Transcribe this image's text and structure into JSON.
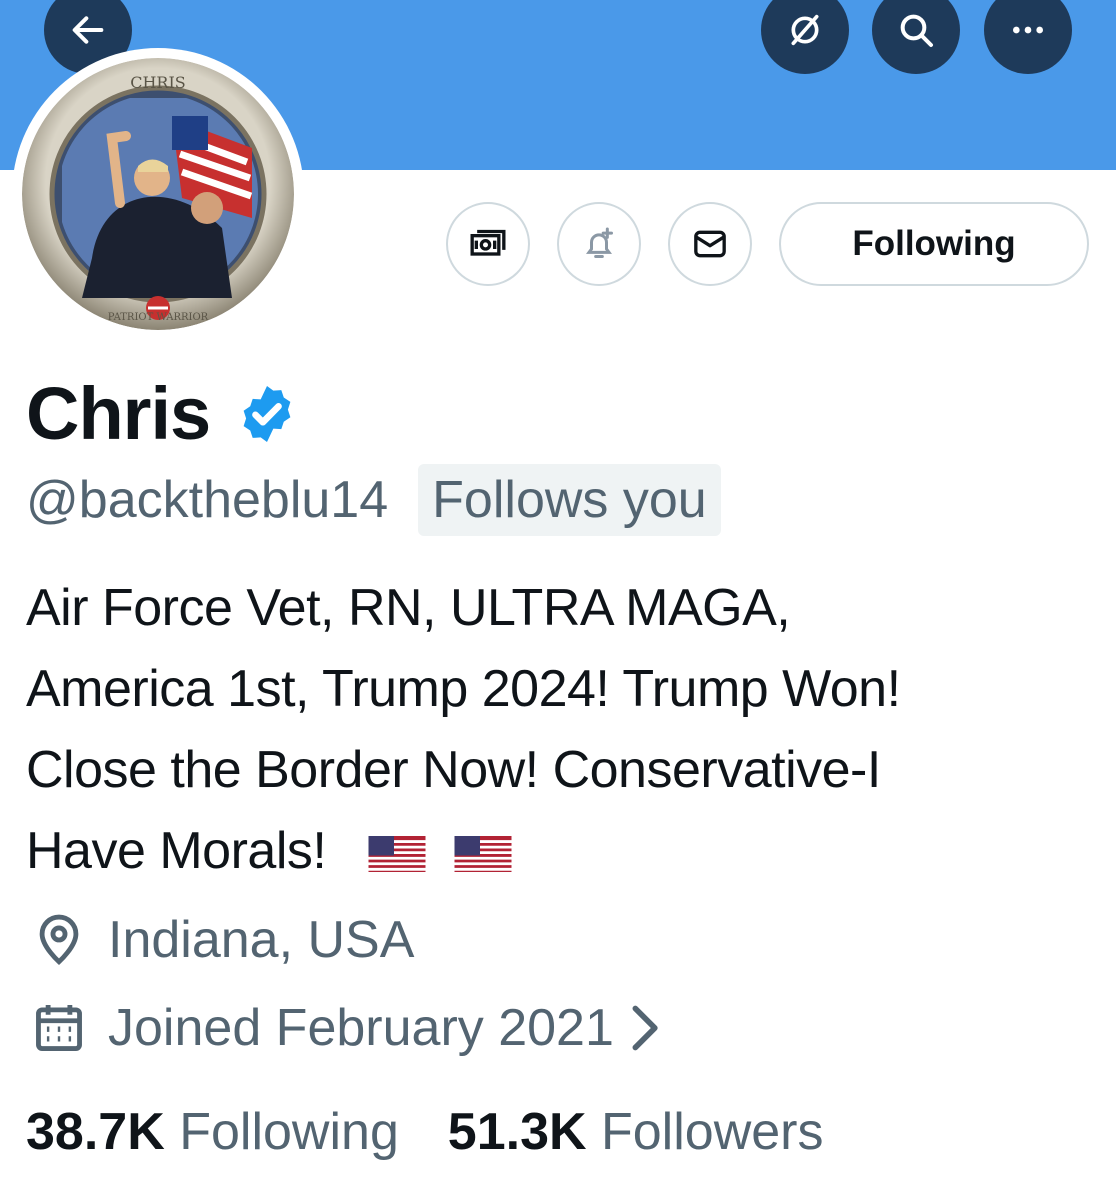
{
  "header": {
    "back_icon": "arrow-left-icon",
    "grok_icon": "slash-circle-icon",
    "search_icon": "search-icon",
    "more_icon": "more-horizontal-icon",
    "banner_color": "#4a99e9"
  },
  "avatar": {
    "seal_text_top": "CHRIS",
    "seal_text_ring": "PATRIOT WARRIOR"
  },
  "actions": {
    "subscribe_icon": "money-icon",
    "notify_icon": "bell-plus-icon",
    "message_icon": "envelope-icon",
    "following_label": "Following"
  },
  "profile": {
    "name": "Chris",
    "verified_icon": "verified-badge-icon",
    "handle": "@backtheblu14",
    "follows_you": "Follows you",
    "bio_lines": [
      "Air Force Vet, RN, ULTRA MAGA,",
      "America 1st, Trump 2024! Trump Won!",
      "Close the Border Now! Conservative-I",
      "Have Morals!"
    ],
    "bio_flags": "🇺🇸 🇺🇸",
    "location": "Indiana, USA",
    "location_icon": "location-pin-icon",
    "joined": "Joined February 2021",
    "joined_icon": "calendar-icon"
  },
  "stats": {
    "following_count": "38.7K",
    "following_label": "Following",
    "followers_count": "51.3K",
    "followers_label": "Followers"
  }
}
